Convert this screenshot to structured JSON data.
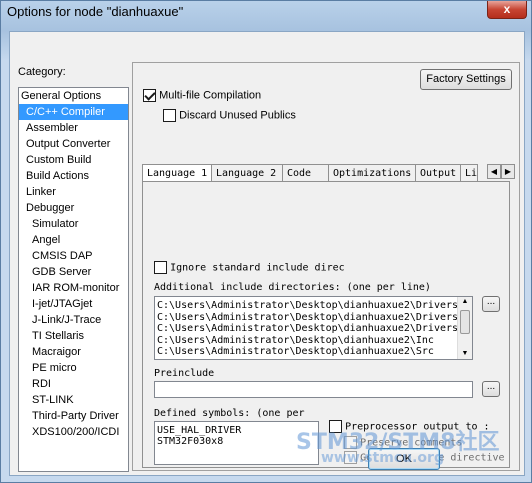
{
  "window": {
    "title": "Options for node \"dianhuaxue\"",
    "close_glyph": "x"
  },
  "category": {
    "label": "Category:",
    "items": [
      {
        "label": "General Options",
        "indent": false
      },
      {
        "label": "C/C++ Compiler",
        "indent": true,
        "selected": true
      },
      {
        "label": "Assembler",
        "indent": true
      },
      {
        "label": "Output Converter",
        "indent": true
      },
      {
        "label": "Custom Build",
        "indent": true
      },
      {
        "label": "Build Actions",
        "indent": true
      },
      {
        "label": "Linker",
        "indent": true
      },
      {
        "label": "Debugger",
        "indent": true
      },
      {
        "label": "Simulator",
        "indent": true,
        "deep": true
      },
      {
        "label": "Angel",
        "indent": true,
        "deep": true
      },
      {
        "label": "CMSIS DAP",
        "indent": true,
        "deep": true
      },
      {
        "label": "GDB Server",
        "indent": true,
        "deep": true
      },
      {
        "label": "IAR ROM-monitor",
        "indent": true,
        "deep": true
      },
      {
        "label": "I-jet/JTAGjet",
        "indent": true,
        "deep": true
      },
      {
        "label": "J-Link/J-Trace",
        "indent": true,
        "deep": true
      },
      {
        "label": "TI Stellaris",
        "indent": true,
        "deep": true
      },
      {
        "label": "Macraigor",
        "indent": true,
        "deep": true
      },
      {
        "label": "PE micro",
        "indent": true,
        "deep": true
      },
      {
        "label": "RDI",
        "indent": true,
        "deep": true
      },
      {
        "label": "ST-LINK",
        "indent": true,
        "deep": true
      },
      {
        "label": "Third-Party Driver",
        "indent": true,
        "deep": true
      },
      {
        "label": "XDS100/200/ICDI",
        "indent": true,
        "deep": true
      }
    ]
  },
  "options": {
    "factory_settings": "Factory Settings",
    "multi_file": "Multi-file Compilation",
    "discard_unused": "Discard Unused Publics",
    "tabs": [
      "Language 1",
      "Language 2",
      "Code",
      "Optimizations",
      "Output",
      "Li"
    ],
    "ignore_std": "Ignore standard include direc",
    "additional_include_label": "Additional include directories: (one per line)",
    "include_dirs": [
      "C:\\Users\\Administrator\\Desktop\\dianhuaxue2\\Drivers\\",
      "C:\\Users\\Administrator\\Desktop\\dianhuaxue2\\Drivers\\",
      "C:\\Users\\Administrator\\Desktop\\dianhuaxue2\\Drivers\\",
      "C:\\Users\\Administrator\\Desktop\\dianhuaxue2\\Inc",
      "C:\\Users\\Administrator\\Desktop\\dianhuaxue2\\Src"
    ],
    "browse": "...",
    "preinclude_label": "Preinclude",
    "preinclude_value": "",
    "defined_symbols_label": "Defined symbols: (one per",
    "defined_symbols": [
      "USE_HAL_DRIVER",
      "STM32F030x8"
    ],
    "preprocessor_output": "Preprocessor output to :",
    "preserve_comments": "Preserve comments",
    "generate_line": "Generate #line directive"
  },
  "footer": {
    "ok": "OK",
    "watermark": "STM32/STM8社区",
    "watermark_url": "www.stmcu.org"
  }
}
